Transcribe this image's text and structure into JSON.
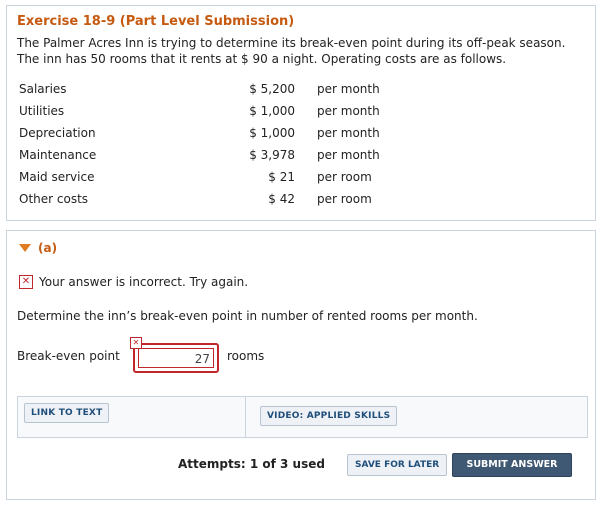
{
  "problem": {
    "title": "Exercise 18-9 (Part Level Submission)",
    "description": "The Palmer Acres Inn is trying to determine its break-even point during its off-peak season. The inn has 50 rooms that it rents at $ 90  a night. Operating costs are as follows.",
    "costs": [
      {
        "label": "Salaries",
        "amount": "$ 5,200",
        "unit": "per month"
      },
      {
        "label": "Utilities",
        "amount": "$ 1,000",
        "unit": "per month"
      },
      {
        "label": "Depreciation",
        "amount": "$ 1,000",
        "unit": "per month"
      },
      {
        "label": "Maintenance",
        "amount": "$ 3,978",
        "unit": "per month"
      },
      {
        "label": "Maid service",
        "amount": "$ 21",
        "unit": "per room"
      },
      {
        "label": "Other costs",
        "amount": "$ 42",
        "unit": "per room"
      }
    ]
  },
  "part": {
    "label": "(a)",
    "status_message": "Your answer is incorrect.  Try again.",
    "question": "Determine the inn’s break-even point in number of rented rooms per month.",
    "answer_label": "Break-even point",
    "answer_value": "27",
    "answer_unit": "rooms",
    "link_to_text": "LINK TO TEXT",
    "video_applied_skills": "VIDEO: APPLIED SKILLS",
    "attempts": "Attempts: 1 of 3 used",
    "save_for_later": "SAVE FOR LATER",
    "submit_answer": "SUBMIT ANSWER"
  },
  "colors": {
    "title_orange": "#c65a11",
    "error_red": "#c0272d",
    "submit_blue": "#3f5873",
    "border_gray": "#c9d4df"
  },
  "icons": {
    "expand": "triangle-down",
    "error": "x-box"
  }
}
